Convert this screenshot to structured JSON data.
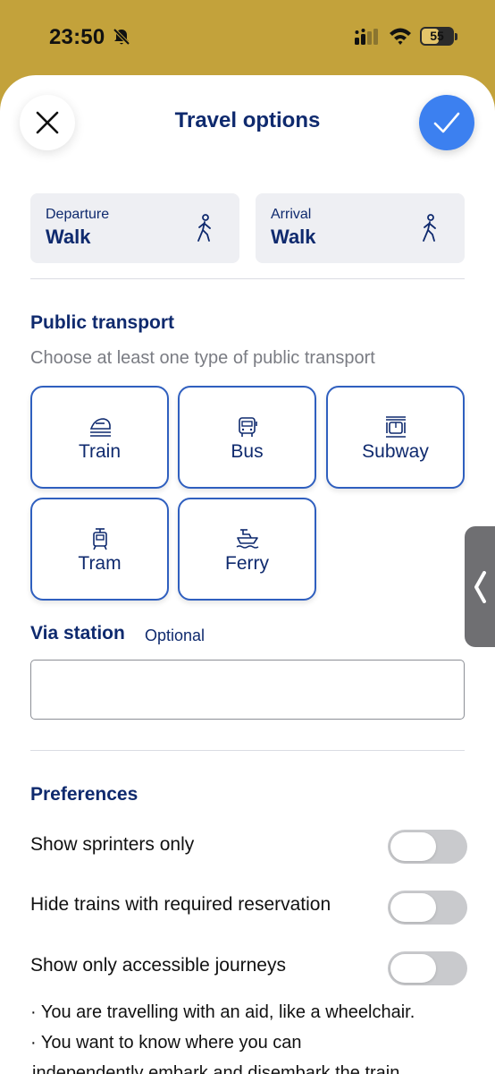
{
  "status_bar": {
    "time": "23:50",
    "battery_label": "55",
    "battery_level": 0.55
  },
  "header": {
    "title": "Travel options",
    "close_icon": "close-icon",
    "confirm_icon": "check-icon"
  },
  "departure": {
    "label": "Departure",
    "value": "Walk",
    "icon": "walk-icon"
  },
  "arrival": {
    "label": "Arrival",
    "value": "Walk",
    "icon": "walk-icon"
  },
  "public_transport": {
    "title": "Public transport",
    "subtitle": "Choose at least one type of public transport",
    "options": [
      {
        "label": "Train",
        "icon": "train-icon"
      },
      {
        "label": "Bus",
        "icon": "bus-icon"
      },
      {
        "label": "Subway",
        "icon": "subway-icon"
      },
      {
        "label": "Tram",
        "icon": "tram-icon"
      },
      {
        "label": "Ferry",
        "icon": "ferry-icon"
      }
    ]
  },
  "via_station": {
    "title": "Via station",
    "optional_label": "Optional",
    "value": "",
    "placeholder": ""
  },
  "preferences": {
    "title": "Preferences",
    "items": [
      {
        "label": "Show sprinters only",
        "enabled": false
      },
      {
        "label": "Hide trains with required reservation",
        "enabled": false
      },
      {
        "label": "Show only accessible journeys",
        "enabled": false
      }
    ],
    "accessible_notes": [
      "· You are travelling with an aid, like a wheelchair.",
      "· You want to know where you can",
      "independently embark and disembark the train."
    ]
  },
  "colors": {
    "status_bar_bg": "#c3a23b",
    "brand_navy": "#0f2a6e",
    "tile_border": "#2f5fbf",
    "confirm_blue": "#3c80f0",
    "toggle_off": "#c9cacd"
  }
}
